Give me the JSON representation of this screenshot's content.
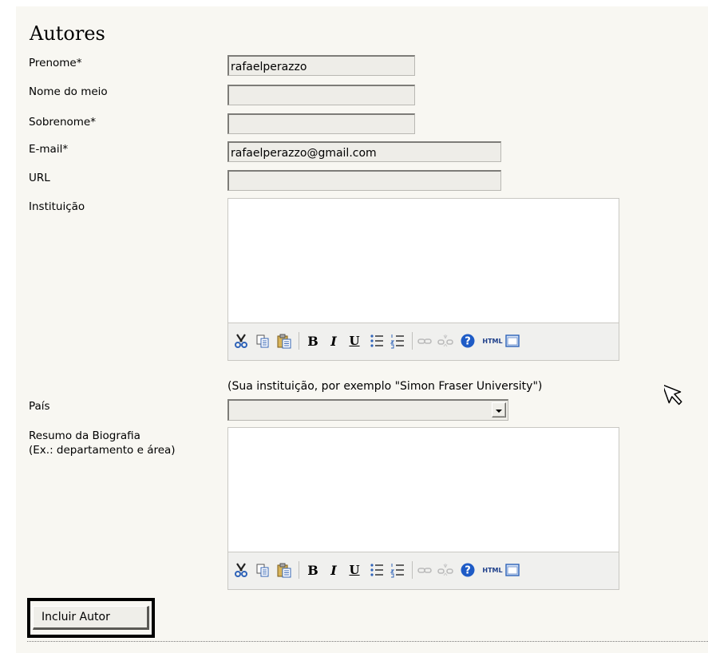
{
  "section": {
    "title": "Autores"
  },
  "fields": {
    "first_name": {
      "label": "Prenome*",
      "value": "rafaelperazzo"
    },
    "middle_name": {
      "label": "Nome do meio",
      "value": ""
    },
    "last_name": {
      "label": "Sobrenome*",
      "value": ""
    },
    "email": {
      "label": "E-mail*",
      "value": "rafaelperazzo@gmail.com"
    },
    "url": {
      "label": "URL",
      "value": ""
    },
    "affiliation": {
      "label": "Instituição",
      "hint": "(Sua instituição, por exemplo \"Simon Fraser University\")"
    },
    "country": {
      "label": "País",
      "selected": ""
    },
    "biography": {
      "label_line1": "Resumo da Biografia",
      "label_line2": "(Ex.: departamento e área)"
    }
  },
  "editor_toolbar": {
    "icons": [
      "cut-icon",
      "copy-icon",
      "paste-icon",
      "bold-icon",
      "italic-icon",
      "underline-icon",
      "bullet-list-icon",
      "numbered-list-icon",
      "link-icon",
      "unlink-icon",
      "help-icon",
      "html-icon",
      "fullscreen-icon"
    ],
    "glyphs": {
      "bold": "B",
      "italic": "I",
      "underline": "U",
      "html": "HTML"
    }
  },
  "actions": {
    "add_author": "Incluir Autor"
  },
  "colors": {
    "panel_bg": "#f8f7f2",
    "field_bg": "#eeede8",
    "toolbar_bg": "#f0f0ee",
    "help_blue": "#1e5bc6"
  }
}
